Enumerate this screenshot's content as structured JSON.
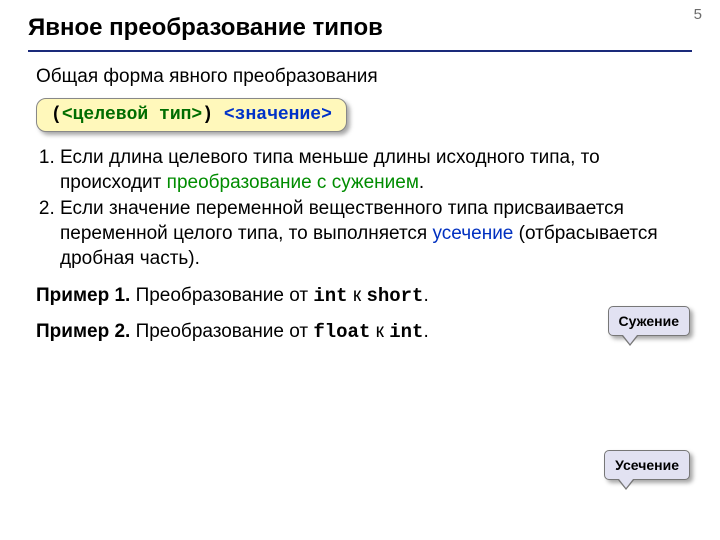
{
  "page_number": "5",
  "title": "Явное преобразование типов",
  "intro": "Общая форма явного преобразования",
  "syntax": {
    "open": "(",
    "target": "<целевой тип>",
    "close": ")",
    "value": "<значение>"
  },
  "rules": [
    {
      "before": "Если длина целевого типа меньше длины исходного типа, то происходит ",
      "highlight": "преобразование с сужением",
      "highlight_class": "hl-green",
      "after": "."
    },
    {
      "before": "Если значение переменной вещественного типа присваивается переменной целого типа, то выполняется ",
      "highlight": "усечение",
      "highlight_class": "hl-blue",
      "after": " (отбрасывается дробная часть)."
    }
  ],
  "examples": [
    {
      "label": "Пример 1.",
      "pre": " Преобразование от ",
      "from": "int",
      "mid": " к ",
      "to": "short",
      "post": "."
    },
    {
      "label": "Пример 2.",
      "pre": " Преобразование от ",
      "from": "float",
      "mid": " к ",
      "to": "int",
      "post": "."
    }
  ],
  "bubbles": {
    "narrowing": "Сужение",
    "truncation": "Усечение"
  }
}
